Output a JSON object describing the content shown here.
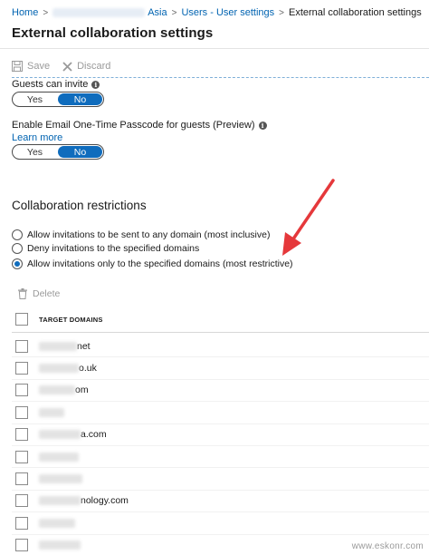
{
  "breadcrumb": {
    "home": "Home",
    "tenant_suffix": "Asia",
    "users_settings": "Users - User settings",
    "current": "External collaboration settings"
  },
  "page_title": "External collaboration settings",
  "toolbar": {
    "save_label": "Save",
    "discard_label": "Discard"
  },
  "guests_can_invite": {
    "label": "Guests can invite",
    "yes": "Yes",
    "no": "No",
    "selected": "No"
  },
  "email_otp": {
    "label": "Enable Email One-Time Passcode for guests (Preview)",
    "learn_more": "Learn more",
    "yes": "Yes",
    "no": "No",
    "selected": "No"
  },
  "collaboration_restrictions": {
    "title": "Collaboration restrictions",
    "options": [
      "Allow invitations to be sent to any domain (most inclusive)",
      "Deny invitations to the specified domains",
      "Allow invitations only to the specified domains (most restrictive)"
    ],
    "selected_index": 2
  },
  "delete_label": "Delete",
  "table": {
    "header": "TARGET DOMAINS",
    "rows": [
      "net",
      "o.uk",
      "om",
      "",
      "a.com",
      "",
      "",
      "nology.com",
      "",
      ""
    ]
  },
  "watermark": "www.eskonr.com",
  "colors": {
    "link": "#0063b1",
    "toggle_active": "#0f6cbd",
    "annotation_arrow": "#e5383b"
  }
}
